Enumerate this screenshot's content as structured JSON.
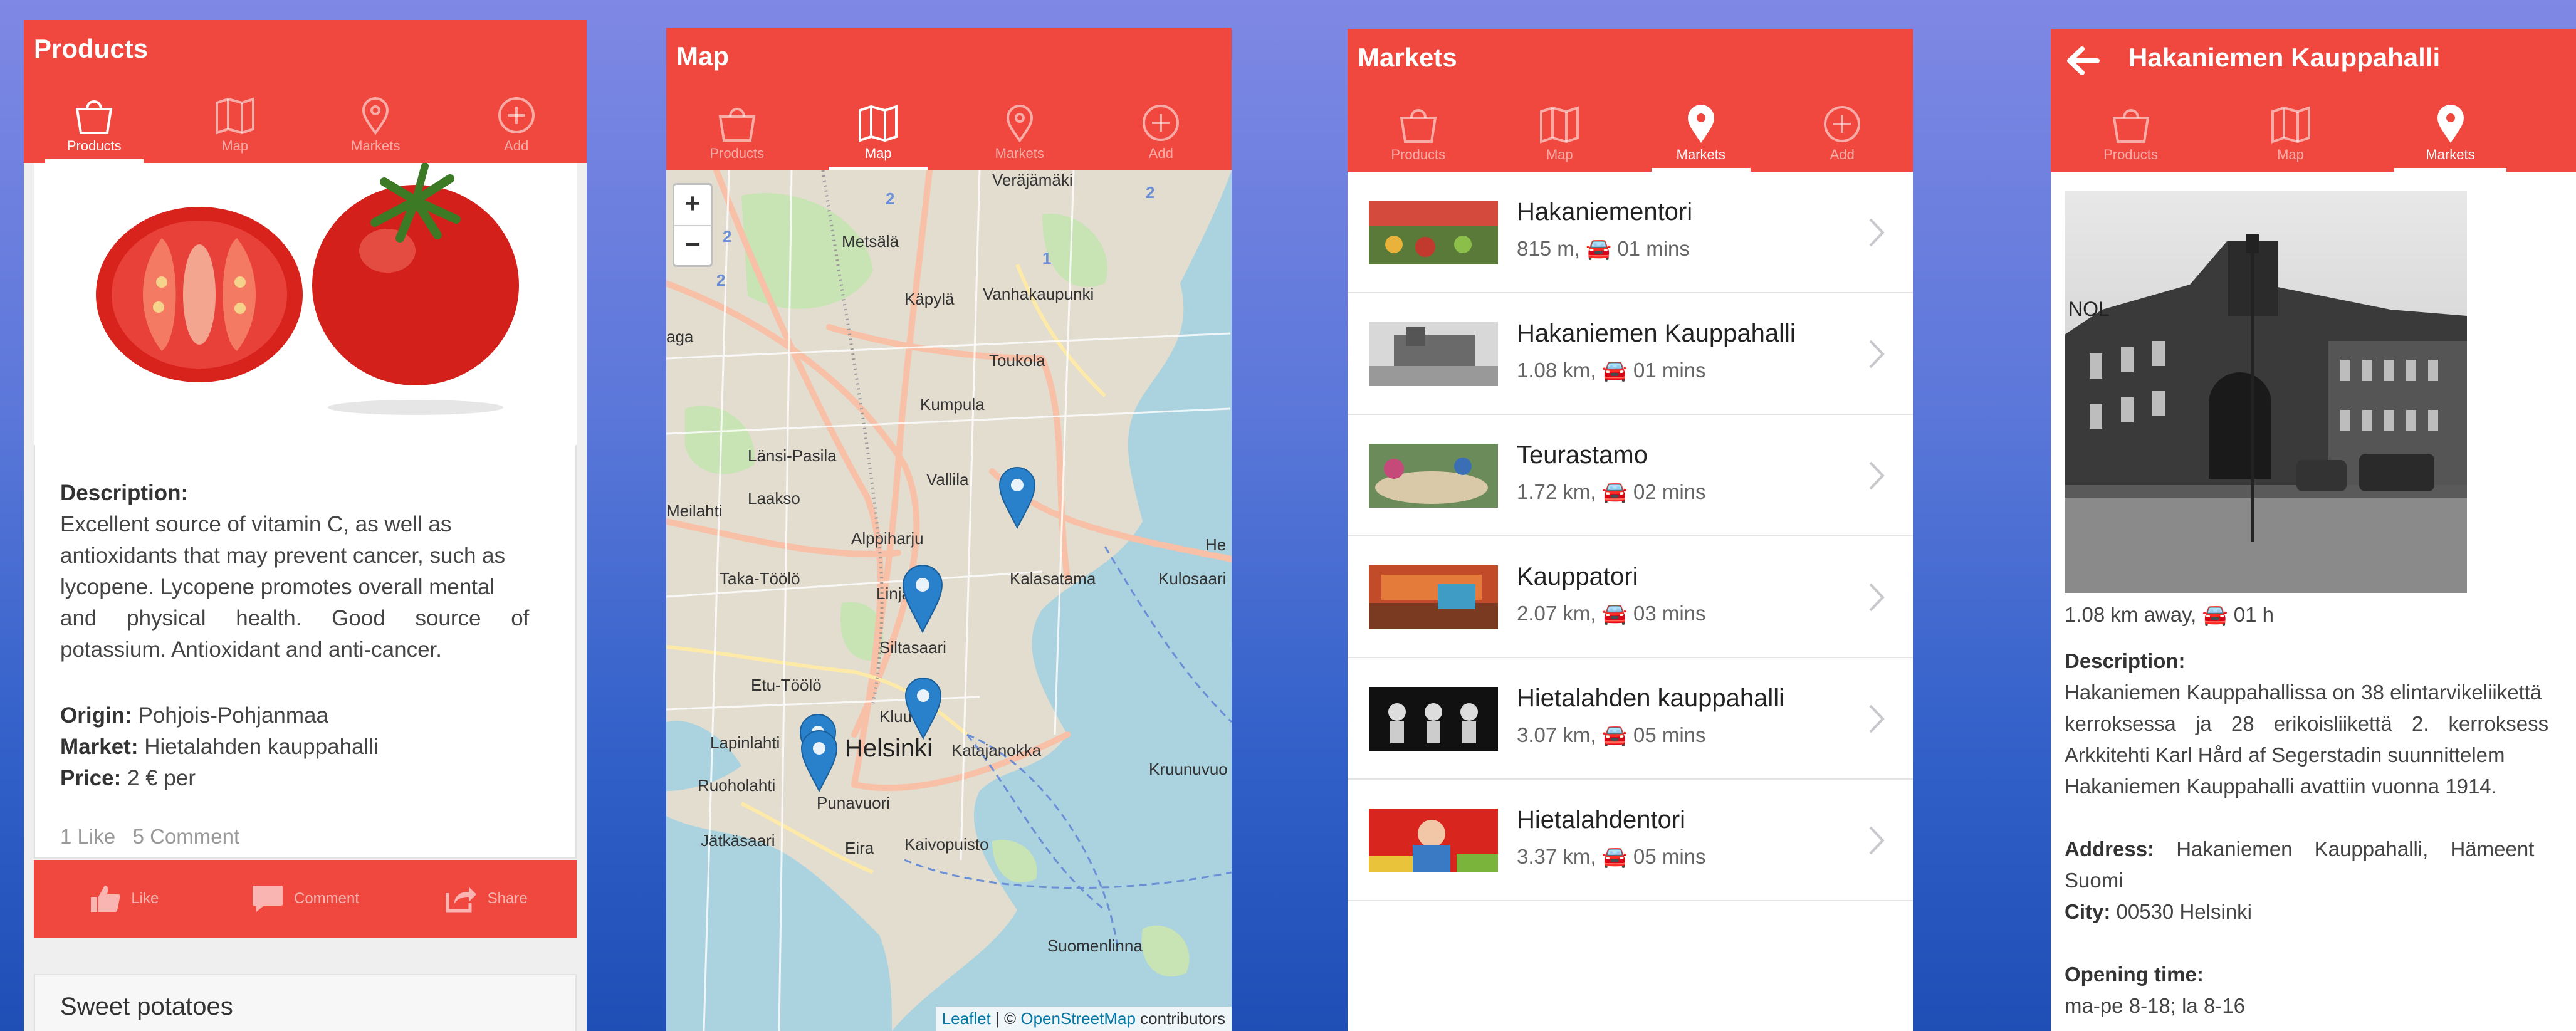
{
  "tabs": [
    {
      "label": "Products"
    },
    {
      "label": "Map"
    },
    {
      "label": "Markets"
    },
    {
      "label": "Add"
    }
  ],
  "screen1": {
    "title": "Products",
    "description_label": "Description:",
    "description_lines": [
      "Excellent source of vitamin C, as well as",
      "antioxidants that may prevent cancer, such as",
      "lycopene. Lycopene promotes overall mental",
      "and physical health. Good source of",
      "potassium. Antioxidant and anti-cancer."
    ],
    "origin_label": "Origin:",
    "origin_value": "Pohjois-Pohjanmaa",
    "market_label": "Market:",
    "market_value": "Hietalahden kauppahalli",
    "price_label": "Price:",
    "price_value": "2 € per",
    "likes": "1 Like",
    "comments": "5 Comment",
    "actions": {
      "like": "Like",
      "comment": "Comment",
      "share": "Share"
    },
    "next_product": "Sweet potatoes"
  },
  "screen2": {
    "title": "Map",
    "zoom_in": "+",
    "zoom_out": "−",
    "places": [
      "Veräjämäki",
      "Metsälä",
      "Käpylä",
      "Vanhakaupunki",
      "Toukola",
      "Kumpula",
      "Länsi-Pasila",
      "Vallila",
      "Laakso",
      "Meilahti",
      "Alppiharju",
      "Taka-Töölö",
      "Kalasatama",
      "Kulosaari",
      "Siltasaari",
      "Etu-Töölö",
      "Kluuvi",
      "Lapinlahti",
      "Helsinki",
      "Katajanokka",
      "Kruunuvuo",
      "Ruoholahti",
      "Punavuori",
      "Jätkäsaari",
      "Eira",
      "Kaivopuisto",
      "Suomenlinna",
      "aga",
      "He",
      "Linja"
    ],
    "route_numbers": [
      "2",
      "2",
      "2",
      "1",
      "2"
    ],
    "attribution": {
      "leaflet": "Leaflet",
      "sep": " | © ",
      "osm": "OpenStreetMap",
      "rest": " contributors"
    }
  },
  "screen3": {
    "title": "Markets",
    "markets": [
      {
        "name": "Hakaniementori",
        "distance": "815 m,",
        "time": "01 mins"
      },
      {
        "name": "Hakaniemen Kauppahalli",
        "distance": "1.08 km,",
        "time": "01 mins"
      },
      {
        "name": "Teurastamo",
        "distance": "1.72 km,",
        "time": "02 mins"
      },
      {
        "name": "Kauppatori",
        "distance": "2.07 km,",
        "time": "03 mins"
      },
      {
        "name": "Hietalahden kauppahalli",
        "distance": "3.07 km,",
        "time": "05 mins"
      },
      {
        "name": "Hietalahdentori",
        "distance": "3.37 km,",
        "time": "05 mins"
      }
    ]
  },
  "screen4": {
    "title": "Hakaniemen Kauppahalli",
    "distance": "1.08 km away,",
    "time": "01 h",
    "description_label": "Description:",
    "description_lines": [
      "Hakaniemen Kauppahallissa on 38 elintarvikeliikettä",
      "kerroksessa ja 28 erikoisliikettä 2. kerroksess",
      "Arkkitehti Karl Hård af Segerstadin suunnittelem",
      "Hakaniemen Kauppahalli avattiin vuonna 1914."
    ],
    "address_label": "Address:",
    "address_value": "Hakaniemen Kauppahalli, Hämeent",
    "address_line2": "Suomi",
    "city_label": "City:",
    "city_value": "00530 Helsinki",
    "opening_label": "Opening time:",
    "opening_value": "ma-pe 8-18; la 8-16",
    "image_sign": "NOL"
  },
  "colors": {
    "brand": "#f0483e",
    "marker": "#2a81cb"
  }
}
